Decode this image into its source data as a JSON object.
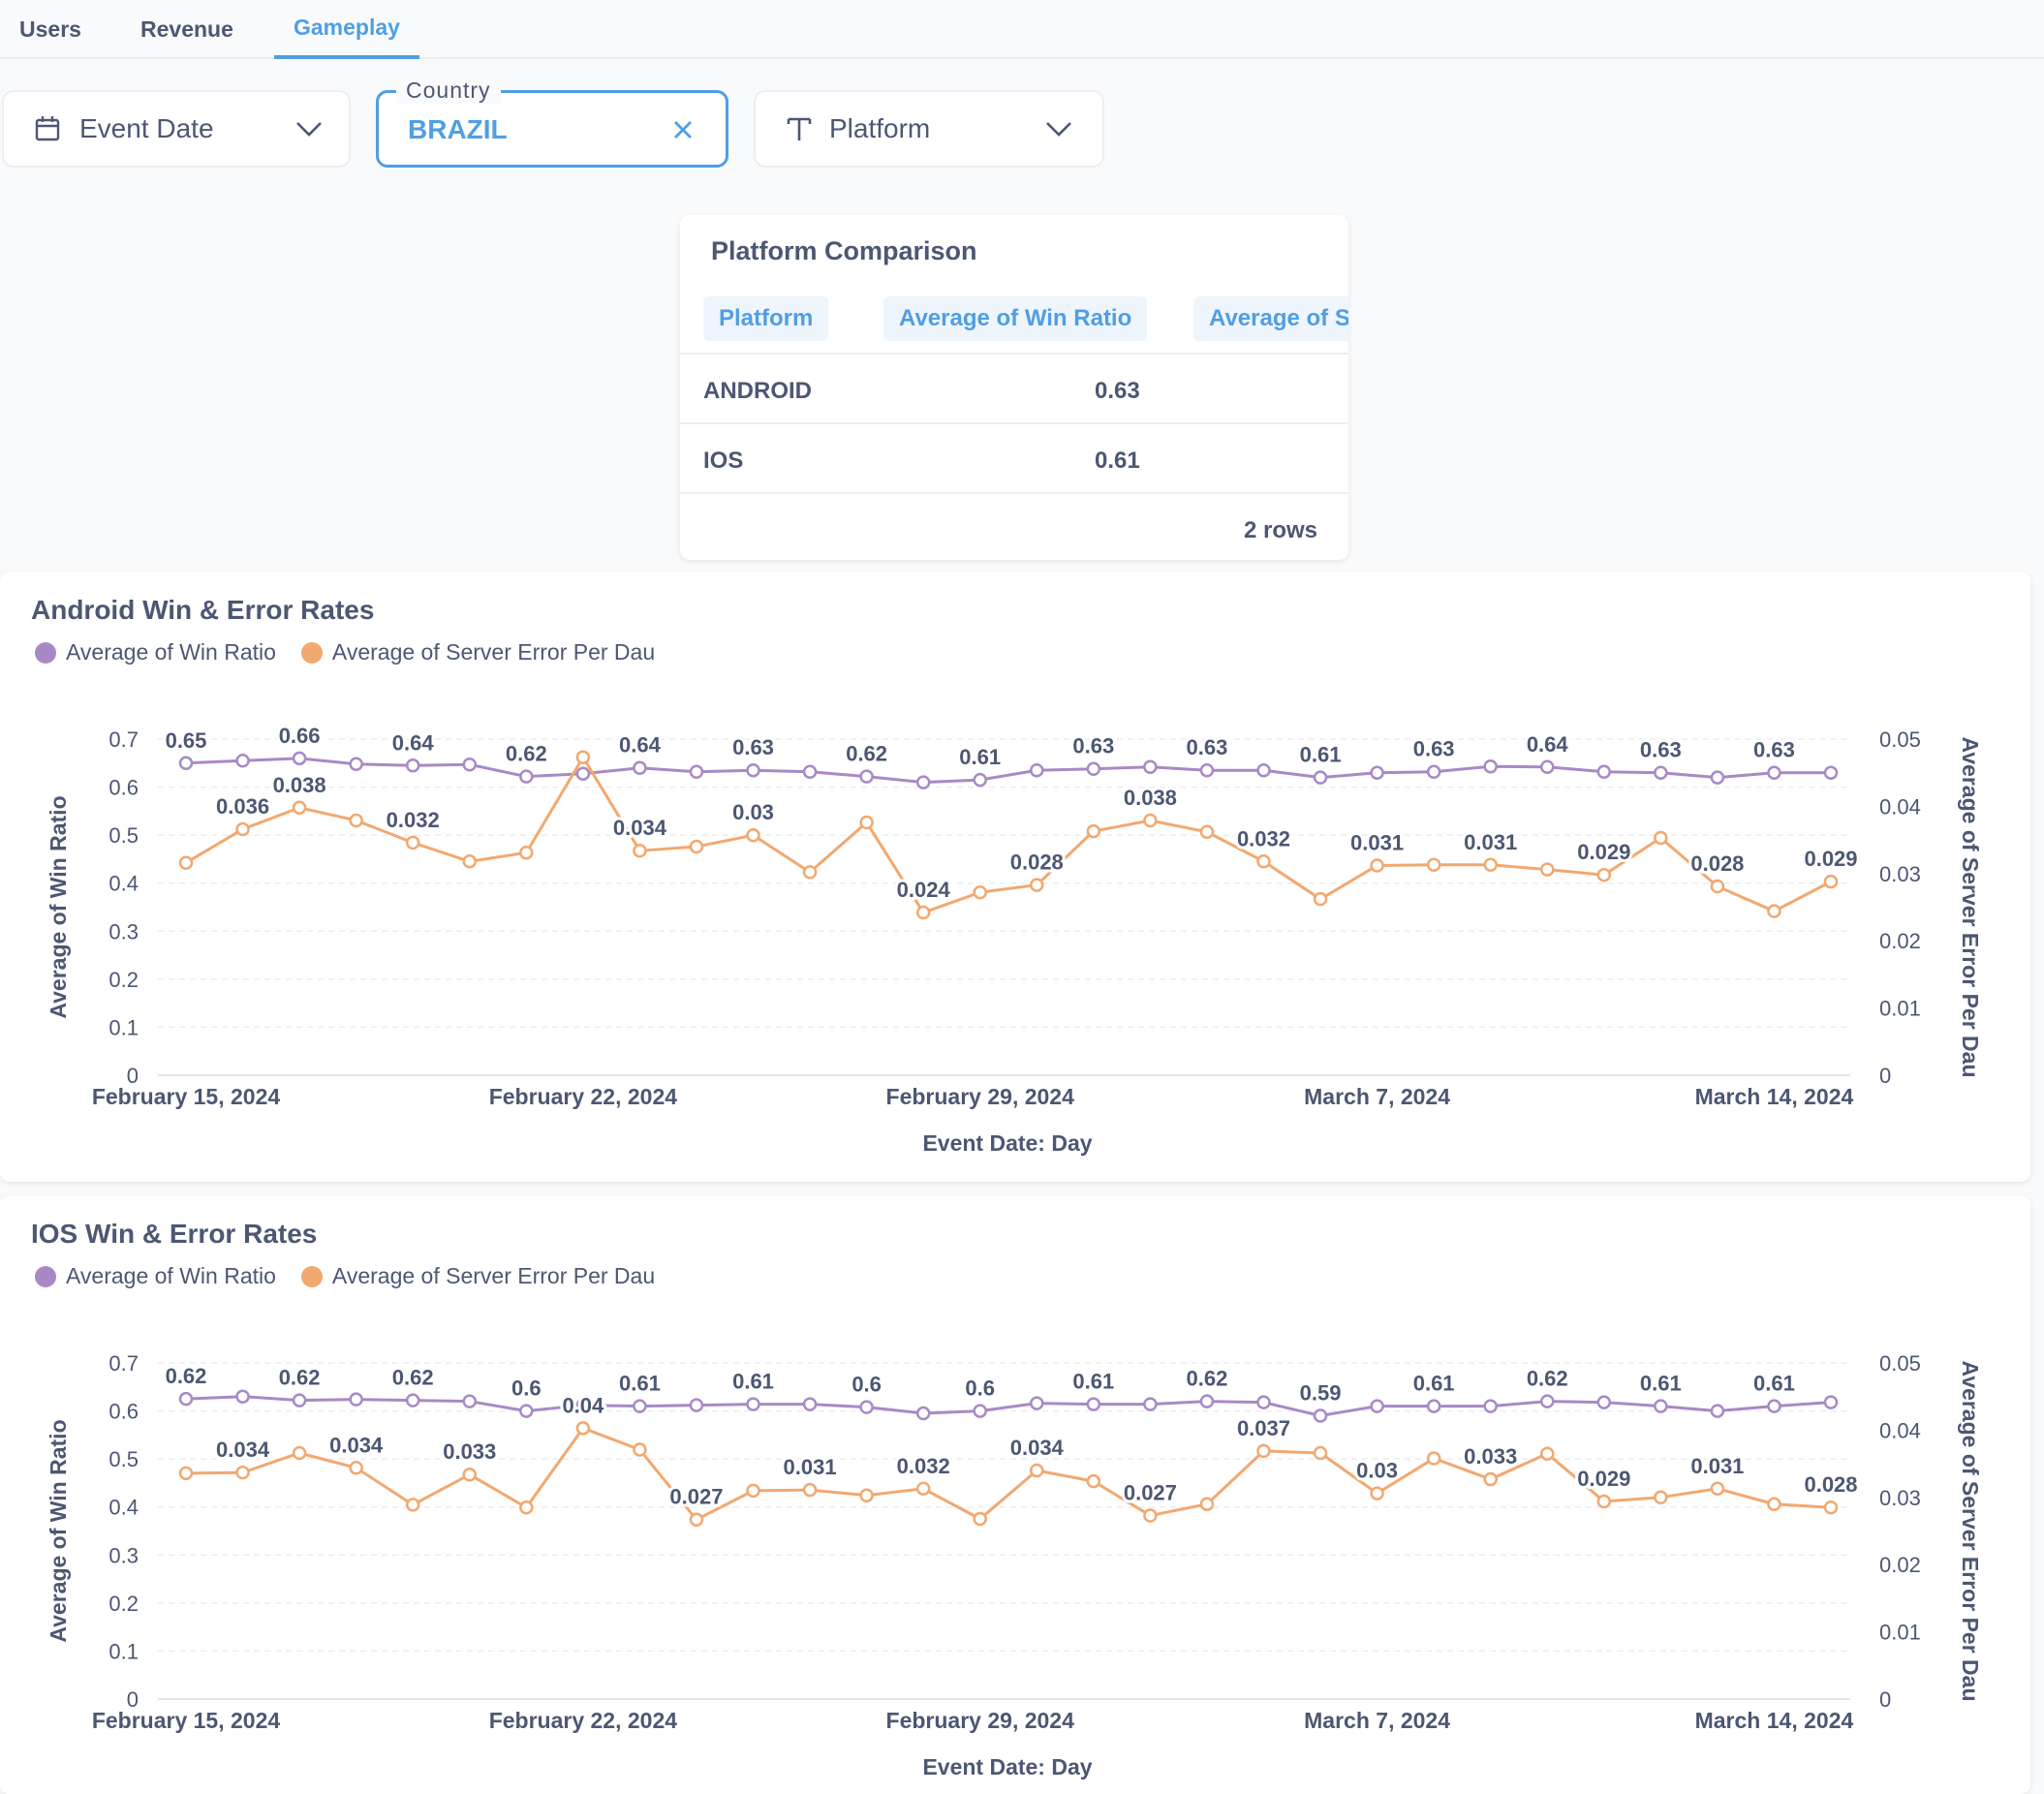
{
  "tabs": [
    {
      "label": "Users",
      "active": false
    },
    {
      "label": "Revenue",
      "active": false
    },
    {
      "label": "Gameplay",
      "active": true
    }
  ],
  "filters": {
    "event_date": {
      "label": "Event Date",
      "icon": "calendar-icon"
    },
    "country": {
      "legend": "Country",
      "value": "BRAZIL",
      "icon": "close-icon"
    },
    "platform": {
      "label": "Platform",
      "icon": "text-icon"
    }
  },
  "colors": {
    "accent": "#509ee3",
    "win": "#a989c5",
    "error": "#f2a86f",
    "text": "#4c5773"
  },
  "table": {
    "title": "Platform Comparison",
    "columns": [
      "Platform",
      "Average of Win Ratio",
      "Average of Se"
    ],
    "rows": [
      {
        "platform": "ANDROID",
        "win_ratio": "0.63"
      },
      {
        "platform": "IOS",
        "win_ratio": "0.61"
      }
    ],
    "row_count": "2 rows"
  },
  "chart_data": [
    {
      "type": "line",
      "title": "Android Win & Error Rates",
      "xlabel": "Event Date: Day",
      "ylabel": "Average of Win Ratio",
      "y2label": "Average of Server Error Per Dau",
      "ylim": [
        0,
        0.7
      ],
      "y2lim": [
        0,
        0.05
      ],
      "y_ticks": [
        "0",
        "0.1",
        "0.2",
        "0.3",
        "0.4",
        "0.5",
        "0.6",
        "0.7"
      ],
      "y2_ticks": [
        "0",
        "0.01",
        "0.02",
        "0.03",
        "0.04",
        "0.05"
      ],
      "x_ticks": [
        "February 15, 2024",
        "February 22, 2024",
        "February 29, 2024",
        "March 7, 2024",
        "March 14, 2024"
      ],
      "x_tick_index": [
        0,
        7,
        14,
        21,
        28
      ],
      "legend": [
        "Average of Win Ratio",
        "Average of Server Error Per Dau"
      ],
      "series": [
        {
          "name": "Average of Win Ratio",
          "axis": "left",
          "values": [
            0.65,
            0.655,
            0.66,
            0.648,
            0.645,
            0.647,
            0.622,
            0.628,
            0.64,
            0.632,
            0.635,
            0.632,
            0.622,
            0.61,
            0.615,
            0.635,
            0.638,
            0.642,
            0.635,
            0.635,
            0.62,
            0.63,
            0.632,
            0.643,
            0.642,
            0.632,
            0.63,
            0.62,
            0.63,
            0.63
          ],
          "labels": [
            "0.65",
            "",
            "0.66",
            "",
            "0.64",
            "",
            "0.62",
            "",
            "0.64",
            "",
            "0.63",
            "",
            "0.62",
            "",
            "0.61",
            "",
            "0.63",
            "",
            "0.63",
            "",
            "0.61",
            "",
            "0.63",
            "",
            "0.64",
            "",
            "0.63",
            "",
            "0.63",
            ""
          ]
        },
        {
          "name": "Average of Server Error Per Dau",
          "axis": "right",
          "values": [
            0.0316,
            0.0366,
            0.0398,
            0.0379,
            0.0346,
            0.0318,
            0.0331,
            0.0473,
            0.0334,
            0.034,
            0.0357,
            0.0302,
            0.0376,
            0.0242,
            0.0272,
            0.0283,
            0.0363,
            0.0379,
            0.0362,
            0.0318,
            0.0262,
            0.0312,
            0.0313,
            0.0313,
            0.0306,
            0.0298,
            0.0353,
            0.0281,
            0.0244,
            0.0288
          ],
          "labels": [
            "",
            "0.036",
            "0.038",
            "",
            "0.032",
            "",
            "",
            "",
            "0.034",
            "",
            "0.03",
            "",
            "",
            "0.024",
            "",
            "0.028",
            "",
            "0.038",
            "",
            "0.032",
            "",
            "0.031",
            "",
            "0.031",
            "",
            "0.029",
            "",
            "0.028",
            "",
            "0.029"
          ]
        }
      ]
    },
    {
      "type": "line",
      "title": "IOS Win & Error Rates",
      "xlabel": "Event Date: Day",
      "ylabel": "Average of Win Ratio",
      "y2label": "Average of Server Error Per Dau",
      "ylim": [
        0,
        0.7
      ],
      "y2lim": [
        0,
        0.05
      ],
      "y_ticks": [
        "0",
        "0.1",
        "0.2",
        "0.3",
        "0.4",
        "0.5",
        "0.6",
        "0.7"
      ],
      "y2_ticks": [
        "0",
        "0.01",
        "0.02",
        "0.03",
        "0.04",
        "0.05"
      ],
      "x_ticks": [
        "February 15, 2024",
        "February 22, 2024",
        "February 29, 2024",
        "March 7, 2024",
        "March 14, 2024"
      ],
      "x_tick_index": [
        0,
        7,
        14,
        21,
        28
      ],
      "legend": [
        "Average of Win Ratio",
        "Average of Server Error Per Dau"
      ],
      "series": [
        {
          "name": "Average of Win Ratio",
          "axis": "left",
          "values": [
            0.625,
            0.63,
            0.622,
            0.624,
            0.622,
            0.62,
            0.6,
            0.612,
            0.61,
            0.612,
            0.614,
            0.614,
            0.608,
            0.595,
            0.6,
            0.616,
            0.614,
            0.614,
            0.62,
            0.618,
            0.59,
            0.61,
            0.61,
            0.61,
            0.62,
            0.618,
            0.61,
            0.6,
            0.61,
            0.618
          ],
          "labels": [
            "0.62",
            "",
            "0.62",
            "",
            "0.62",
            "",
            "0.6",
            "",
            "0.61",
            "",
            "0.61",
            "",
            "0.6",
            "",
            "0.6",
            "",
            "0.61",
            "",
            "0.62",
            "",
            "0.59",
            "",
            "0.61",
            "",
            "0.62",
            "",
            "0.61",
            "",
            "0.61",
            ""
          ]
        },
        {
          "name": "Average of Server Error Per Dau",
          "axis": "right",
          "values": [
            0.0336,
            0.0337,
            0.0366,
            0.0344,
            0.0289,
            0.0334,
            0.0285,
            0.0403,
            0.0371,
            0.0267,
            0.031,
            0.0311,
            0.0303,
            0.0313,
            0.0268,
            0.034,
            0.0324,
            0.0273,
            0.029,
            0.0369,
            0.0366,
            0.0306,
            0.0358,
            0.0327,
            0.0365,
            0.0294,
            0.03,
            0.0313,
            0.029,
            0.0285
          ],
          "labels": [
            "",
            "0.034",
            "",
            "0.034",
            "",
            "0.033",
            "",
            "0.04",
            "",
            "0.027",
            "",
            "0.031",
            "",
            "0.032",
            "",
            "0.034",
            "",
            "0.027",
            "",
            "0.037",
            "",
            "0.03",
            "",
            "0.033",
            "",
            "0.029",
            "",
            "0.031",
            "",
            "0.028"
          ]
        }
      ]
    }
  ]
}
